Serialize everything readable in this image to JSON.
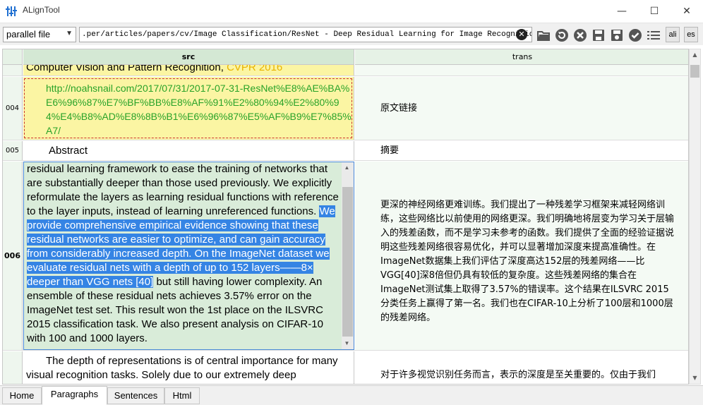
{
  "window": {
    "title": "ALignTool",
    "buttons": {
      "minimize": "—",
      "maximize": "☐",
      "close": "✕"
    }
  },
  "toolbar": {
    "mode_value": "parallel file",
    "path_value": ".per/articles/papers/cv/Image Classification/ResNet - Deep Residual Learning for Image Recognition.txt",
    "btn_ali": "ali",
    "btn_es": "es"
  },
  "grid": {
    "header": {
      "src": "src",
      "trans": "trans"
    },
    "row_partial": {
      "src_prefix": "Computer Vision and Pattern Recognition, ",
      "src_highlight": "CVPR 2016"
    },
    "row_004": {
      "num": "004",
      "src": "http://noahsnail.com/2017/07/31/2017-07-31-ResNet%E8%AE%BA%E6%96%87%E7%BF%BB%E8%AF%91%E2%80%94%E2%80%94%E4%B8%AD%E8%8B%B1%E6%96%87%E5%AF%B9%E7%85%A7/",
      "trans": "原文链接"
    },
    "row_005": {
      "num": "005",
      "src": "Abstract",
      "trans": "摘要"
    },
    "row_006": {
      "num": "006",
      "src_before": "Deeper neural networks are more difficult to train. We present a residual learning framework to ease the training of networks that are substantially deeper than those used previously. We explicitly reformulate the layers as learning residual functions with reference to the layer inputs, instead of learning unreferenced functions. ",
      "src_selected": "We provide comprehensive empirical evidence showing that these residual networks are easier to optimize, and can gain accuracy from considerably increased depth. On the ImageNet dataset we evaluate residual nets with a depth of up to 152 layers——8× deeper than VGG nets [40]",
      "src_after": " but still having lower complexity. An ensemble of these residual nets achieves 3.57% error on the ImageNet test set. This result won the 1st place on the ILSVRC 2015 classification task. We also present analysis on CIFAR-10 with 100 and 1000 layers.",
      "trans": "更深的神经网络更难训练。我们提出了一种残差学习框架来减轻网络训练，这些网络比以前使用的网络更深。我们明确地将层变为学习关于层输入的残差函数，而不是学习未参考的函数。我们提供了全面的经验证据说明这些残差网络很容易优化，并可以显著增加深度来提高准确性。在ImageNet数据集上我们评估了深度高达152层的残差网络——比VGG[40]深8倍但仍具有较低的复杂度。这些残差网络的集合在ImageNet测试集上取得了3.57%的错误率。这个结果在ILSVRC 2015分类任务上赢得了第一名。我们也在CIFAR-10上分析了100层和1000层的残差网络。"
    },
    "row_007": {
      "src": "The depth of representations is of central importance for many visual recognition tasks. Solely due to our extremely deep",
      "trans": "对于许多视觉识别任务而言，表示的深度是至关重要的。仅由于我们"
    }
  },
  "tabs": [
    "Home",
    "Paragraphs",
    "Sentences",
    "Html"
  ],
  "active_tab": "Paragraphs"
}
